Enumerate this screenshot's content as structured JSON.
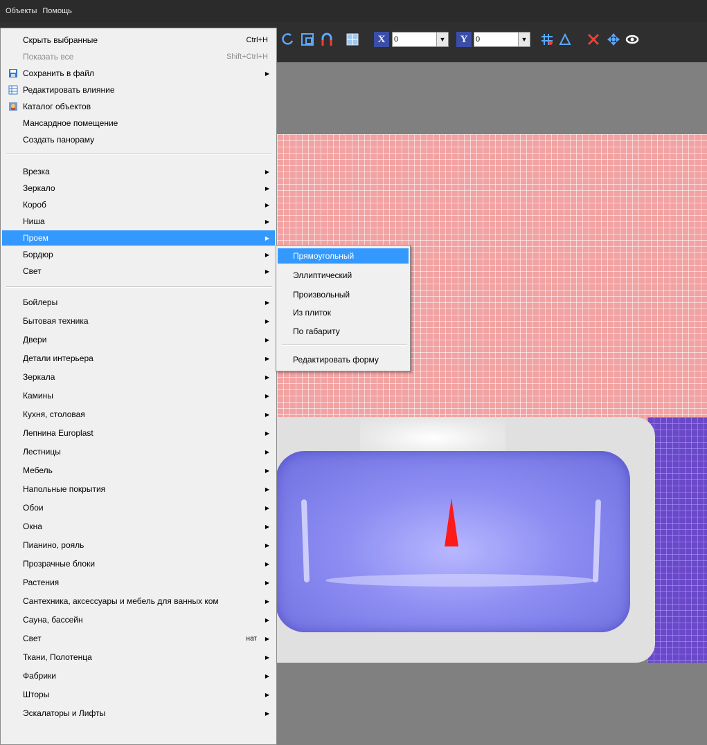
{
  "menubar": {
    "items": [
      "Объекты",
      "Помощь"
    ]
  },
  "toolbar": {
    "x_axis_label": "X",
    "x_value": "0",
    "y_axis_label": "Y",
    "y_value": "0",
    "icons": [
      "curve-icon",
      "rect-select-icon",
      "magnet-icon",
      "grid-image-icon",
      "grid-snap-icon",
      "delta-icon",
      "delete-icon",
      "move-icon",
      "view-icon"
    ]
  },
  "menu": {
    "items": [
      {
        "label": "Скрыть выбранные",
        "shortcut": "Ctrl+H"
      },
      {
        "label": "Показать все",
        "shortcut": "Shift+Ctrl+H"
      },
      {
        "label": "Сохранить в файл"
      },
      {
        "label": "Редактировать влияние"
      },
      {
        "label": "Каталог объектов"
      },
      {
        "label": "Мансардное помещение"
      },
      {
        "label": "Создать панораму"
      },
      {
        "label": "Врезка"
      },
      {
        "label": "Зеркало"
      },
      {
        "label": "Короб"
      },
      {
        "label": "Ниша"
      },
      {
        "label": "Проем"
      },
      {
        "label": "Бордюр"
      },
      {
        "label": "Свет"
      },
      {
        "label": "Бойлеры"
      },
      {
        "label": "Бытовая техника"
      },
      {
        "label": "Двери"
      },
      {
        "label": "Детали интерьера"
      },
      {
        "label": "Зеркала"
      },
      {
        "label": "Камины"
      },
      {
        "label": "Кухня, столовая"
      },
      {
        "label": "Лепнина Europlast"
      },
      {
        "label": "Лестницы"
      },
      {
        "label": "Мебель"
      },
      {
        "label": "Напольные покрытия"
      },
      {
        "label": "Обои"
      },
      {
        "label": "Окна"
      },
      {
        "label": "Пианино, рояль"
      },
      {
        "label": "Прозрачные блоки"
      },
      {
        "label": "Растения"
      },
      {
        "label": "Сантехника, аксессуары и мебель для ванных ком"
      },
      {
        "label": "Сауна, бассейн"
      },
      {
        "label": "Свет",
        "shortcut": "нат"
      },
      {
        "label": "Ткани, Полотенца"
      },
      {
        "label": "Фабрики"
      },
      {
        "label": "Шторы"
      },
      {
        "label": "Эскалаторы и Лифты"
      }
    ]
  },
  "submenu": {
    "items": [
      {
        "label": "Прямоугольный"
      },
      {
        "label": "Эллиптический"
      },
      {
        "label": "Произвольный"
      },
      {
        "label": "Из плиток"
      },
      {
        "label": "По габариту"
      },
      {
        "label": "Редактировать форму"
      }
    ]
  },
  "colors": {
    "selection": "#3399ff",
    "wall_tile": "#f2a2a2",
    "tub": "#8c8cf2",
    "marker": "#ff1a1a"
  }
}
